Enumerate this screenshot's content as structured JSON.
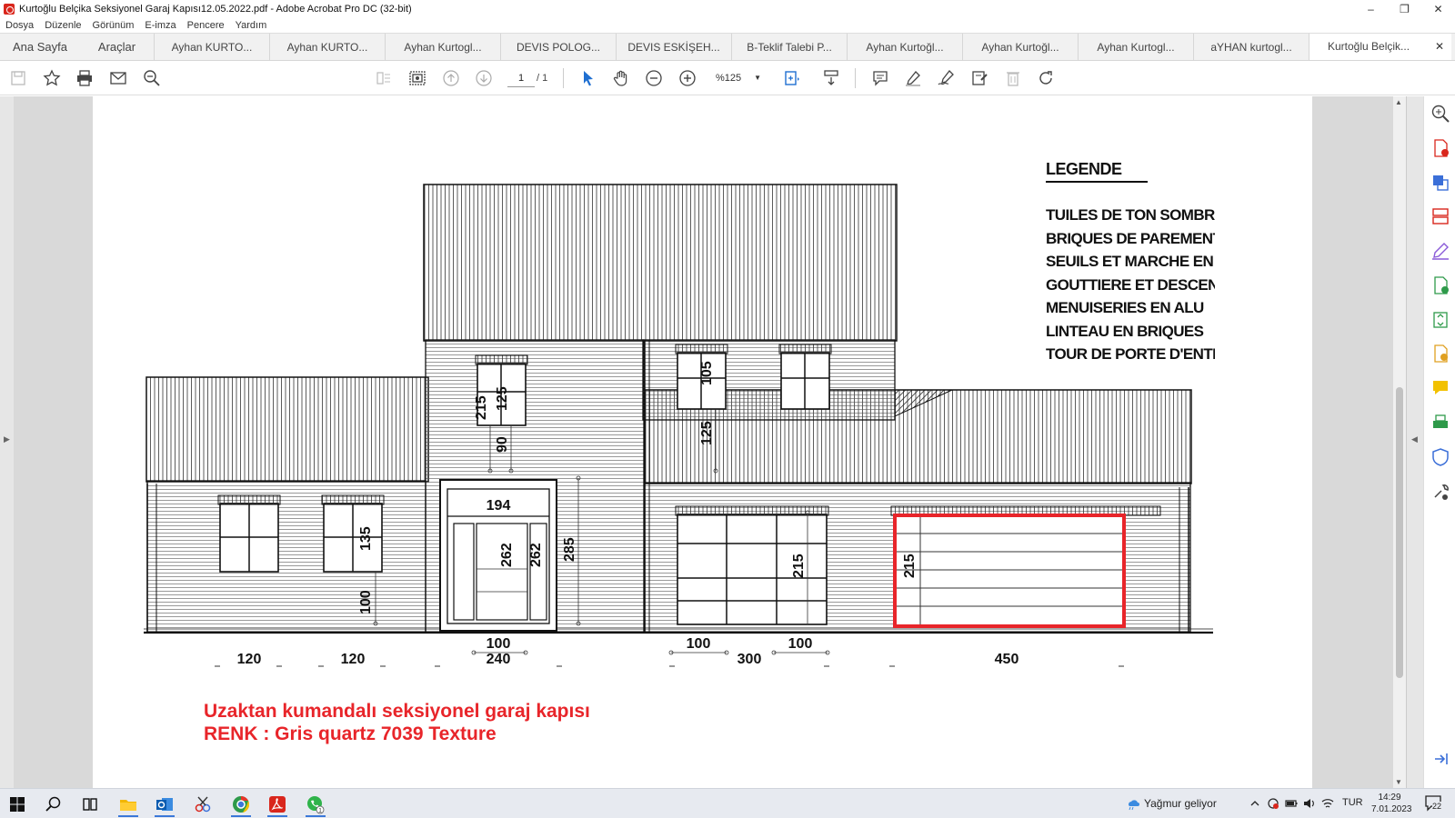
{
  "window": {
    "title": "Kurtoğlu Belçika Seksiyonel Garaj Kapısı12.05.2022.pdf - Adobe Acrobat Pro DC (32-bit)",
    "controls": [
      "–",
      "❐",
      "✕"
    ]
  },
  "menu": [
    "Dosya",
    "Düzenle",
    "Görünüm",
    "E-imza",
    "Pencere",
    "Yardım"
  ],
  "tabs": {
    "home": "Ana Sayfa",
    "tools": "Araçlar",
    "documents": [
      "Ayhan KURTO...",
      "Ayhan KURTO...",
      "Ayhan Kurtogl...",
      "DEVIS POLOG...",
      "DEVIS ESKİŞEH...",
      "B-Teklif Talebi P...",
      "Ayhan Kurtoğl...",
      "Ayhan Kurtoğl...",
      "Ayhan Kurtogl...",
      "aYHAN kurtogl..."
    ],
    "active": "Kurtoğlu Belçik...",
    "close_glyph": "✕"
  },
  "toolbar": {
    "page_current": "1",
    "page_total": "/ 1",
    "zoom": "%125"
  },
  "legend": {
    "title": "LEGENDE",
    "items": [
      "TUILES DE TON SOMBRE",
      "BRIQUES DE PAREMENT",
      "SEUILS ET MARCHE EN",
      "GOUTTIERE ET DESCENTE",
      "MENUISERIES EN ALU",
      "LINTEAU EN BRIQUES",
      "TOUR DE PORTE D'ENTREE"
    ]
  },
  "drawing": {
    "dims_vertical": [
      "215",
      "125",
      "90",
      "105",
      "125",
      "135",
      "100",
      "262",
      "262",
      "285",
      "215",
      "215"
    ],
    "dims_top": [
      "194"
    ],
    "dims_bottom_top": [
      "100",
      "100",
      "100"
    ],
    "dims_bottom": [
      "120",
      "120",
      "240",
      "300",
      "450"
    ],
    "highlight_color": "#e8252a"
  },
  "notes": {
    "line1": "Uzaktan kumandalı seksiyonel garaj kapısı",
    "line2": "RENK : Gris quartz 7039 Texture"
  },
  "taskbar": {
    "weather": "Yağmur geliyor",
    "lang": "TUR",
    "time": "14:29",
    "date": "7.01.2023",
    "notif_count": "22",
    "whatsapp_badge": "1"
  }
}
